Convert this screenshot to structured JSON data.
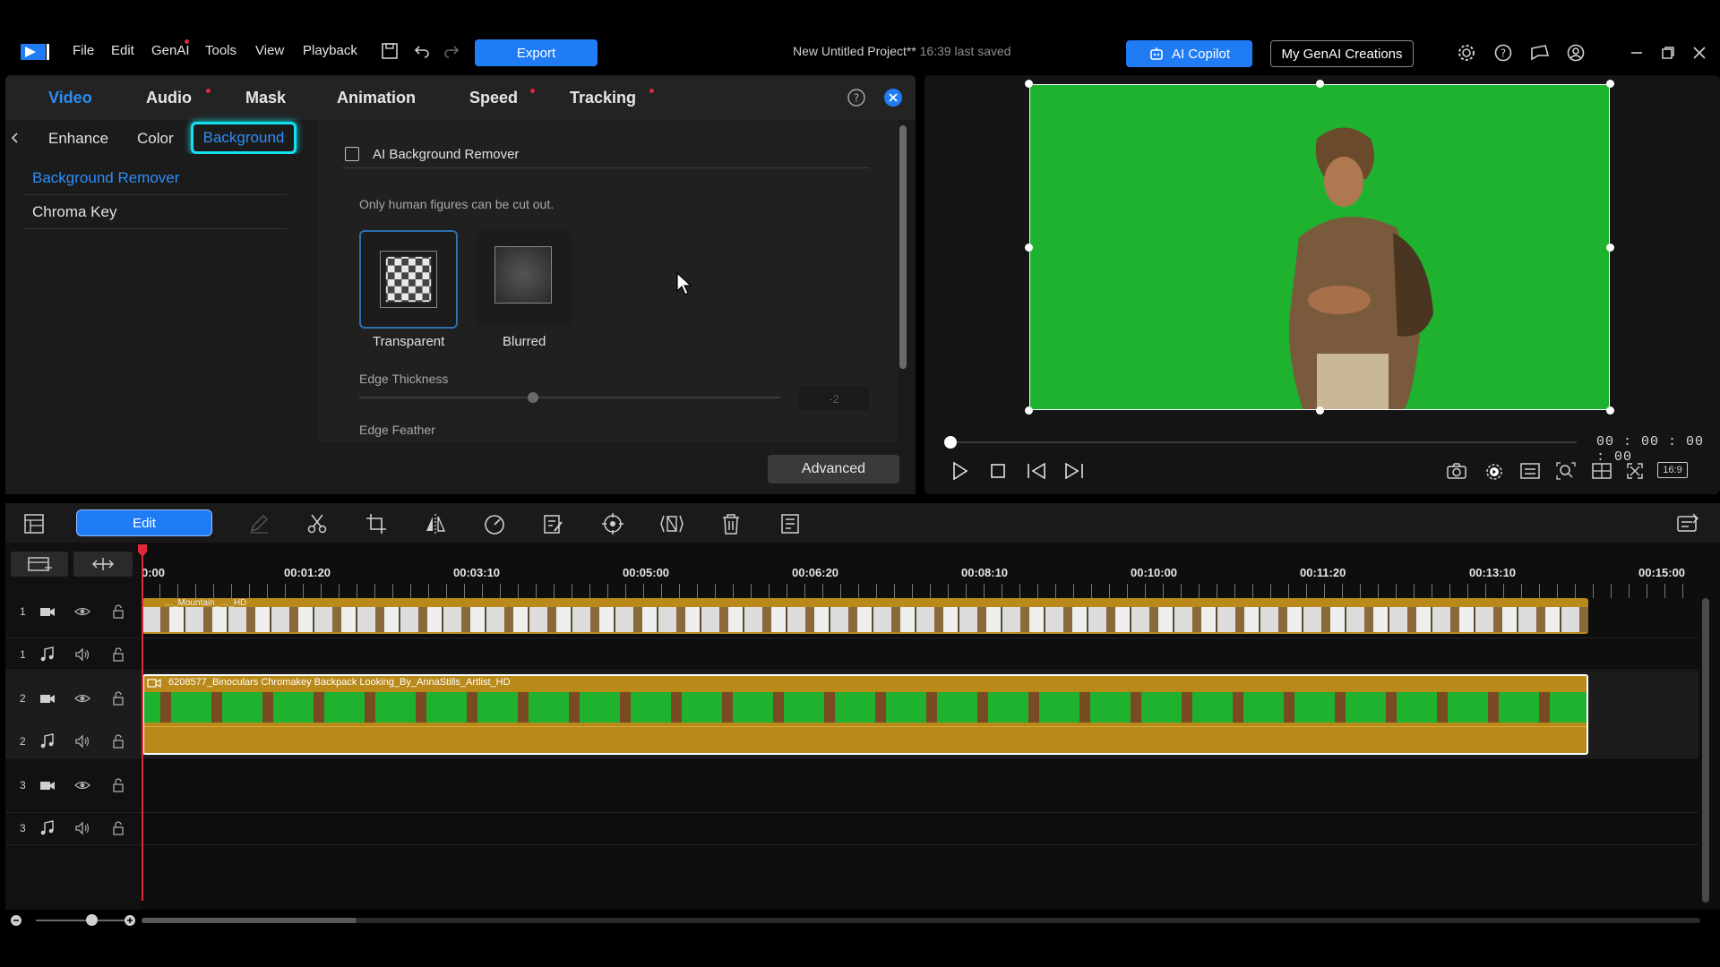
{
  "app": {
    "menu": [
      "File",
      "Edit",
      "GenAI",
      "Tools",
      "View",
      "Playback"
    ],
    "export_label": "Export",
    "project_title": "New Untitled Project**",
    "last_saved": "16:39 last saved",
    "copilot_label": "AI Copilot",
    "genai_creations_label": "My GenAI Creations"
  },
  "panel": {
    "tabs": [
      "Video",
      "Audio",
      "Mask",
      "Animation",
      "Speed",
      "Tracking"
    ],
    "subtabs": [
      "Enhance",
      "Color",
      "Background"
    ],
    "side_items": [
      "Background Remover",
      "Chroma Key"
    ],
    "ai_bg_remover_label": "AI Background Remover",
    "hint": "Only human figures can be cut out.",
    "options": [
      "Transparent",
      "Blurred"
    ],
    "edge_thickness_label": "Edge Thickness",
    "edge_thickness_value": "-2",
    "edge_feather_label": "Edge Feather",
    "advanced_label": "Advanced"
  },
  "preview": {
    "timecode": "00 : 00 : 00 : 00",
    "aspect": "16:9"
  },
  "toolbar": {
    "edit_label": "Edit"
  },
  "timeline": {
    "ticks": [
      "0:00",
      "00:01:20",
      "00:03:10",
      "00:05:00",
      "00:06:20",
      "00:08:10",
      "00:10:00",
      "00:11:20",
      "00:13:10",
      "00:15:00"
    ],
    "track_labels": [
      "1",
      "1",
      "2",
      "2",
      "3",
      "3"
    ],
    "clip1_title": "…_Mountain_…_HD",
    "clip2_title": "6208577_Binoculars Chromakey Backpack Looking_By_AnnaStills_Artlist_HD"
  },
  "colors": {
    "accent": "#1f7cf5",
    "highlight": "#14e1f0",
    "chroma": "#1eb22e",
    "clip": "#b9891a",
    "playhead": "#e02a3c"
  }
}
